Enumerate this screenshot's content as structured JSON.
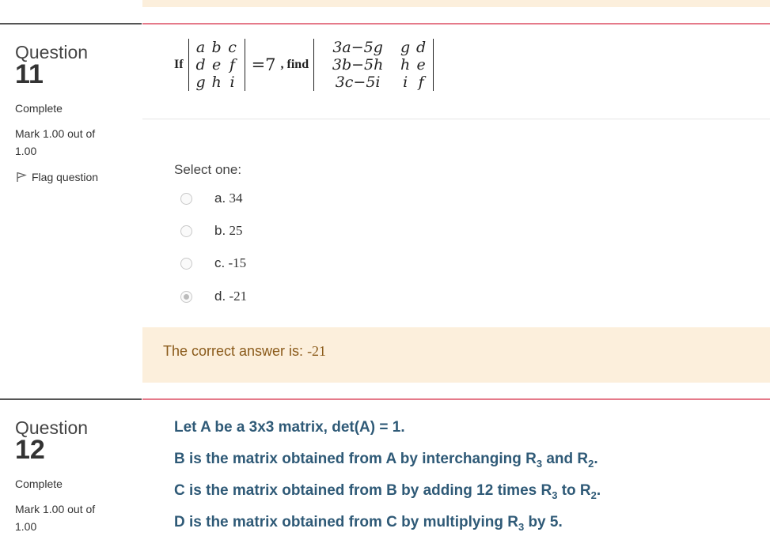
{
  "q11": {
    "question_word": "Question",
    "number": "11",
    "state": "Complete",
    "mark": "Mark 1.00 out of 1.00",
    "flag_label": "Flag question",
    "prompt_if": "If",
    "prompt_equals": "=7",
    "prompt_find": ", find",
    "det1": [
      "a",
      "b",
      "c",
      "d",
      "e",
      "f",
      "g",
      "h",
      "i"
    ],
    "det2": [
      "3a−5g",
      "g",
      "d",
      "3b−5h",
      "h",
      "e",
      "3c−5i",
      "i",
      "f"
    ],
    "select_label": "Select one:",
    "options": [
      {
        "letter": "a.",
        "value": "34",
        "checked": false
      },
      {
        "letter": "b.",
        "value": "25",
        "checked": false
      },
      {
        "letter": "c.",
        "value": "-15",
        "checked": false
      },
      {
        "letter": "d.",
        "value": "-21",
        "checked": true
      }
    ],
    "feedback_prefix": "The correct answer is: ",
    "feedback_value": "-21"
  },
  "q12": {
    "question_word": "Question",
    "number": "12",
    "state": "Complete",
    "mark": "Mark 1.00 out of 1.00",
    "line1": "Let A be a 3x3 matrix, det(A) = 1.",
    "line2_a": "B is the matrix obtained from A by interchanging R",
    "line2_s1": "3",
    "line2_b": " and R",
    "line2_s2": "2",
    "line2_c": ".",
    "line3_a": "C is the matrix obtained from B by adding 12 times R",
    "line3_s1": "3",
    "line3_b": " to R",
    "line3_s2": "2",
    "line3_c": ".",
    "line4_a": "D is the matrix obtained from C by multiplying R",
    "line4_s1": "3",
    "line4_b": " by 5."
  },
  "colors": {
    "feedback_bg": "#fcefdc",
    "accent_rule": "#e57a8a",
    "q12_text": "#2f5a77"
  }
}
